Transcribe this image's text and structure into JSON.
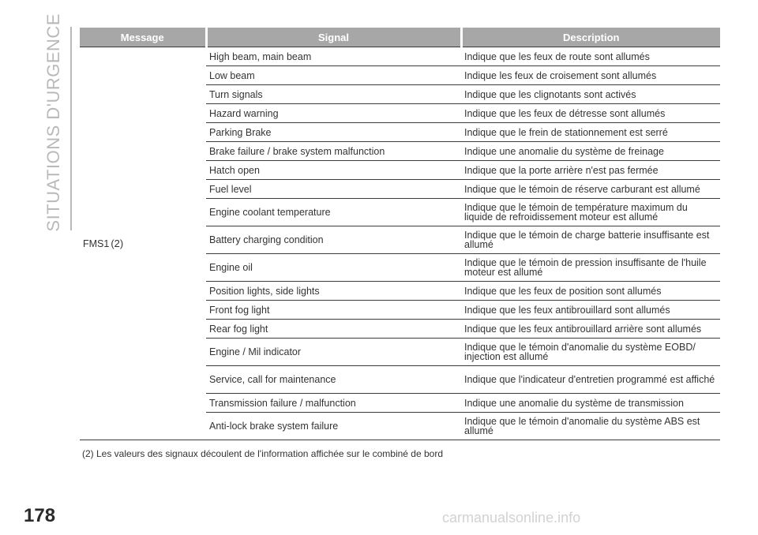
{
  "section_title": "SITUATIONS D'URGENCE",
  "page_number": "178",
  "watermark": "carmanualsonline.info",
  "table": {
    "headers": [
      "Message",
      "Signal",
      "Description"
    ],
    "message": "FMS1",
    "message_ref": "(2)",
    "rows": [
      {
        "signal": "High beam, main beam",
        "description": "Indique que les feux de route sont allumés"
      },
      {
        "signal": "Low beam",
        "description": "Indique les feux de croisement sont allumés"
      },
      {
        "signal": "Turn signals",
        "description": "Indique que les clignotants sont activés"
      },
      {
        "signal": "Hazard warning",
        "description": "Indique que les feux de détresse sont allumés"
      },
      {
        "signal": "Parking Brake",
        "description": "Indique que le frein de stationnement est serré"
      },
      {
        "signal": "Brake failure / brake system malfunction",
        "description": "Indique une anomalie du système de freinage"
      },
      {
        "signal": "Hatch open",
        "description": "Indique que la porte arrière n'est pas fermée"
      },
      {
        "signal": "Fuel level",
        "description": "Indique que le témoin de réserve carburant est allumé"
      },
      {
        "signal": "Engine coolant temperature",
        "description": "Indique que le témoin de température maximum du liquide de refroidissement moteur est allumé"
      },
      {
        "signal": "Battery charging condition",
        "description": "Indique que le témoin de charge batterie insuffisante est allumé"
      },
      {
        "signal": "Engine oil",
        "description": "Indique que le témoin de pression insuffisante de l'huile moteur est allumé"
      },
      {
        "signal": "Position lights, side lights",
        "description": "Indique que les feux de position sont allumés"
      },
      {
        "signal": "Front fog light",
        "description": "Indique que les feux antibrouillard sont allumés"
      },
      {
        "signal": "Rear fog light",
        "description": "Indique que les feux antibrouillard arrière sont allumés"
      },
      {
        "signal": "Engine / Mil indicator",
        "description": "Indique que le témoin d'anomalie du système EOBD/ injection est allumé"
      },
      {
        "signal": "Service, call for maintenance",
        "description": "Indique que l'indicateur d'entretien programmé est affiché"
      },
      {
        "signal": "Transmission failure / malfunction",
        "description": "Indique une anomalie du système de transmission"
      },
      {
        "signal": "Anti-lock brake system failure",
        "description": "Indique que le témoin d'anomalie du système ABS est allumé"
      }
    ]
  },
  "footnote": "(2) Les valeurs des signaux découlent de l'information affichée sur le combiné de bord"
}
